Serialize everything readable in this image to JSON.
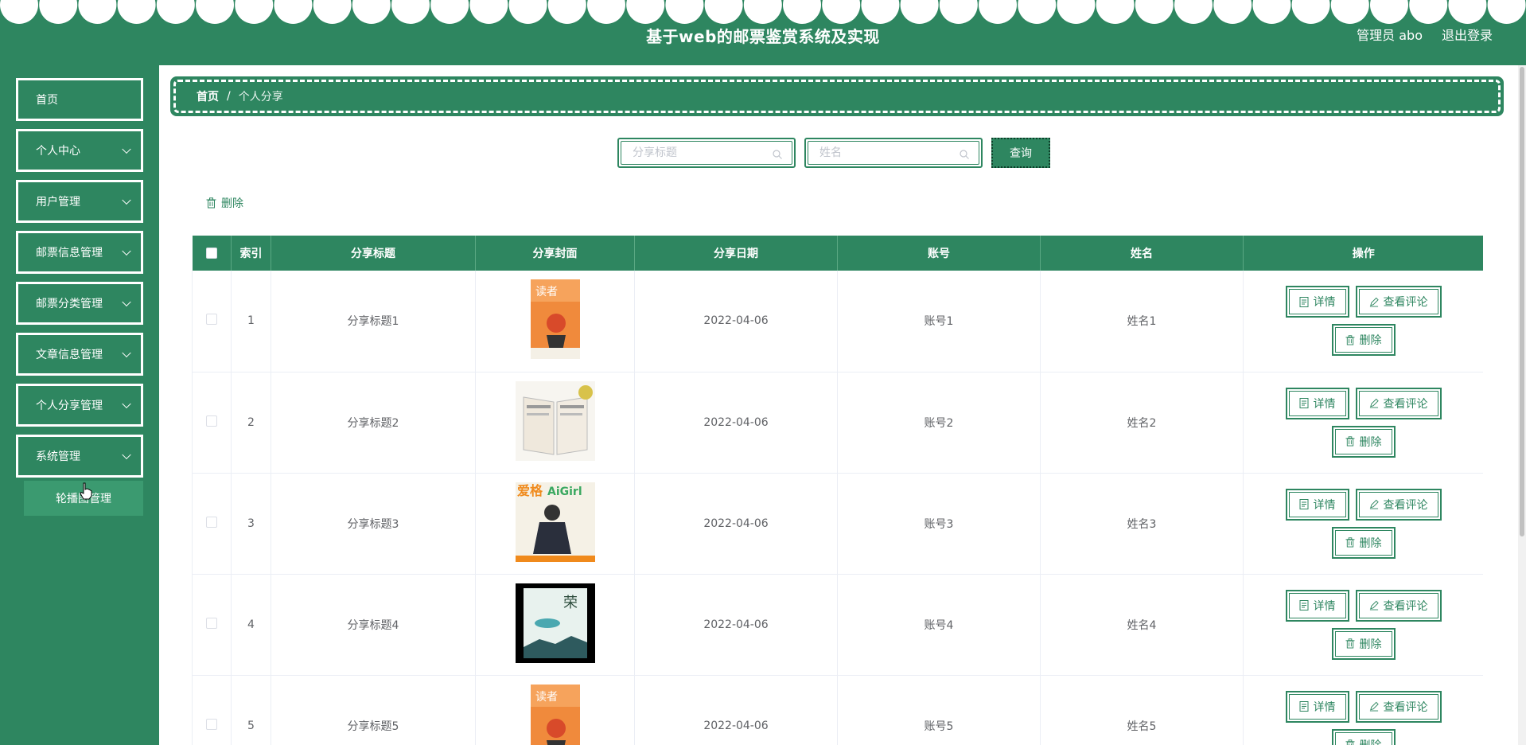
{
  "header": {
    "title": "基于web的邮票鉴赏系统及实现",
    "user_label": "管理员 abo",
    "logout_label": "退出登录"
  },
  "sidebar": {
    "items": [
      {
        "label": "首页",
        "expandable": false
      },
      {
        "label": "个人中心",
        "expandable": true
      },
      {
        "label": "用户管理",
        "expandable": true
      },
      {
        "label": "邮票信息管理",
        "expandable": true
      },
      {
        "label": "邮票分类管理",
        "expandable": true
      },
      {
        "label": "文章信息管理",
        "expandable": true
      },
      {
        "label": "个人分享管理",
        "expandable": true
      },
      {
        "label": "系统管理",
        "expandable": true
      }
    ],
    "submenu": {
      "label": "轮播图管理"
    }
  },
  "breadcrumb": {
    "home": "首页",
    "separator": "/",
    "current": "个人分享"
  },
  "search": {
    "title_placeholder": "分享标题",
    "name_placeholder": "姓名",
    "query_label": "查询"
  },
  "toolbar": {
    "delete_label": "删除"
  },
  "table": {
    "columns": [
      "",
      "索引",
      "分享标题",
      "分享封面",
      "分享日期",
      "账号",
      "姓名",
      "操作"
    ],
    "rows": [
      {
        "index": "1",
        "title": "分享标题1",
        "cover": "duzhe",
        "date": "2022-04-06",
        "account": "账号1",
        "name": "姓名1"
      },
      {
        "index": "2",
        "title": "分享标题2",
        "cover": "openbook",
        "date": "2022-04-06",
        "account": "账号2",
        "name": "姓名2"
      },
      {
        "index": "3",
        "title": "分享标题3",
        "cover": "aige",
        "date": "2022-04-06",
        "account": "账号3",
        "name": "姓名3"
      },
      {
        "index": "4",
        "title": "分享标题4",
        "cover": "dark",
        "date": "2022-04-06",
        "account": "账号4",
        "name": "姓名4"
      },
      {
        "index": "5",
        "title": "分享标题5",
        "cover": "duzhe",
        "date": "2022-04-06",
        "account": "账号5",
        "name": "姓名5"
      }
    ],
    "actions": {
      "detail": "详情",
      "comments": "查看评论",
      "delete": "删除"
    }
  },
  "colors": {
    "primary": "#2e8660",
    "submenu": "#3b9a70",
    "text": "#606266",
    "placeholder": "#c0c4cc"
  }
}
